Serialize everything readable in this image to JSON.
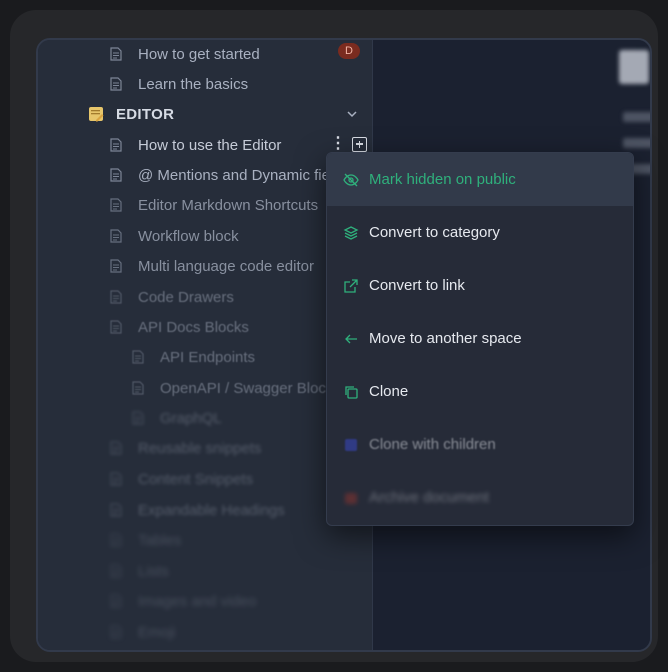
{
  "sidebar": {
    "rows": [
      {
        "label": "How to get started",
        "badge": "D"
      },
      {
        "label": "Learn the basics"
      },
      {
        "label": "EDITOR"
      },
      {
        "label": "How to use the Editor"
      },
      {
        "label": "@ Mentions and Dynamic fields"
      },
      {
        "label": "Editor Markdown Shortcuts"
      },
      {
        "label": "Workflow block"
      },
      {
        "label": "Multi language code editor"
      },
      {
        "label": "Code Drawers"
      },
      {
        "label": "API Docs Blocks"
      },
      {
        "label": "API Endpoints"
      },
      {
        "label": "OpenAPI / Swagger Blocks"
      },
      {
        "label": "GraphQL"
      },
      {
        "label": "Reusable snippets"
      },
      {
        "label": "Content Snippets"
      },
      {
        "label": "Expandable Headings"
      },
      {
        "label": "Tables"
      },
      {
        "label": "Lists"
      },
      {
        "label": "Images and video"
      },
      {
        "label": "Emoji"
      }
    ]
  },
  "context_menu": {
    "items": [
      {
        "label": "Mark hidden on public",
        "icon": "eye-off-icon"
      },
      {
        "label": "Convert to category",
        "icon": "layers-icon"
      },
      {
        "label": "Convert to link",
        "icon": "external-link-icon"
      },
      {
        "label": "Move to another space",
        "icon": "arrow-left-icon"
      },
      {
        "label": "Clone",
        "icon": "copy-icon"
      },
      {
        "label": "Clone with children",
        "icon": "copy-children-icon"
      },
      {
        "label": "Archive document",
        "icon": "archive-icon"
      }
    ]
  },
  "colors": {
    "accent": "#2fb07c",
    "badge": "#7a2b1f",
    "archive": "#c0392b"
  }
}
